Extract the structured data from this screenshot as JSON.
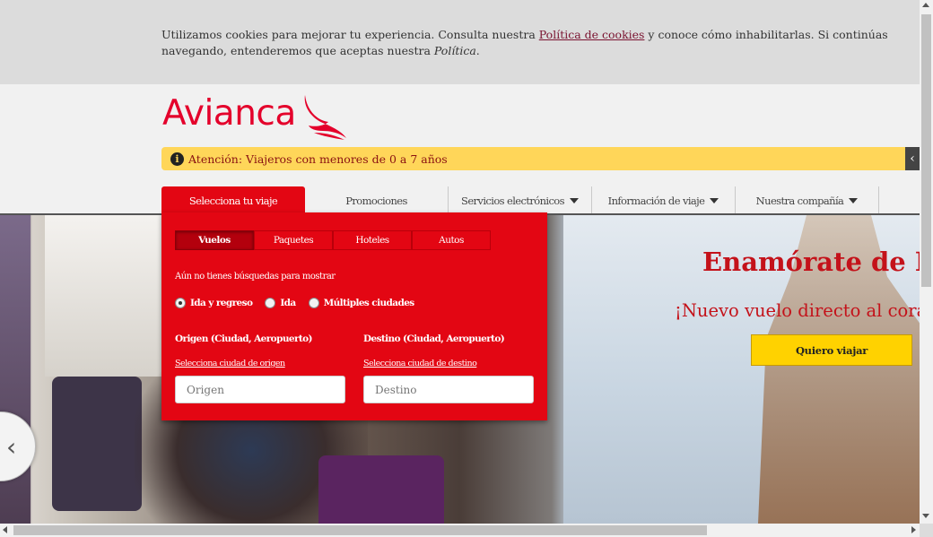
{
  "cookie": {
    "text_before": "Utilizamos cookies para mejorar tu experiencia. Consulta nuestra ",
    "link": "Política de cookies",
    "text_after": " y conoce cómo inhabilitarlas. Si continúas navegando, entenderemos que aceptas nuestra ",
    "policy_word": "Política",
    "end": "."
  },
  "header": {
    "logo_text": "Avianca",
    "alert_icon": "info-icon",
    "alert_text": "Atención: Viajeros con menores de 0 a 7 años",
    "alert_toggle": "‹"
  },
  "nav": {
    "items": [
      {
        "label": "Selecciona tu viaje"
      },
      {
        "label": "Promociones"
      },
      {
        "label": "Servicios electrónicos"
      },
      {
        "label": "Información de viaje"
      },
      {
        "label": "Nuestra compañía"
      }
    ]
  },
  "booking": {
    "tabs": [
      "Vuelos",
      "Paquetes",
      "Hoteles",
      "Autos"
    ],
    "no_searches": "Aún no tienes búsquedas para mostrar",
    "trip_types": [
      "Ida y regreso",
      "Ida",
      "Múltiples ciudades"
    ],
    "origin_label": "Origen (Ciudad, Aeropuerto)",
    "origin_link": "Selecciona ciudad de origen",
    "origin_placeholder": "Origen",
    "dest_label": "Destino (Ciudad, Aeropuerto)",
    "dest_link": "Selecciona ciudad de destino",
    "dest_placeholder": "Destino"
  },
  "hero": {
    "title": "Enamórate de Mún",
    "subtitle": "¡Nuevo vuelo directo al corazón d",
    "cta": "Quiero viajar",
    "prev": "‹"
  },
  "colors": {
    "brand_red": "#e30613",
    "alert_yellow": "#ffd659",
    "cta_yellow": "#ffd200"
  }
}
